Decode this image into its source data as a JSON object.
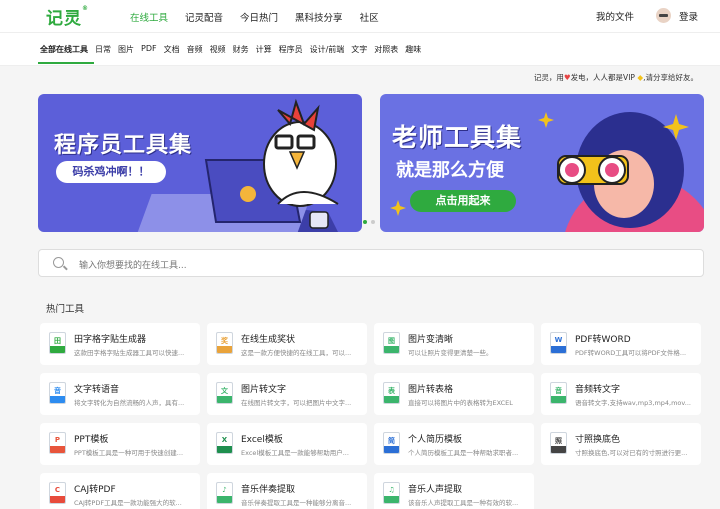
{
  "header": {
    "logo_text": "记灵",
    "logo_mark": "®",
    "nav": [
      "在线工具",
      "记灵配音",
      "今日热门",
      "黑科技分享",
      "社区"
    ],
    "my_files": "我的文件",
    "login": "登录"
  },
  "categories": [
    "全部在线工具",
    "日常",
    "图片",
    "PDF",
    "文档",
    "音频",
    "视频",
    "财务",
    "计算",
    "程序员",
    "设计/前端",
    "文字",
    "对照表",
    "趣味"
  ],
  "notice": {
    "part1": "记灵，用",
    "part2": "发电，人人都是VIP",
    "part3": ",请分享给好友。"
  },
  "banners": {
    "left": {
      "title": "程序员工具集",
      "button": "码杀鸡冲啊！！"
    },
    "right": {
      "title": "老师工具集",
      "subtitle": "就是那么方便",
      "button": "点击用起来"
    }
  },
  "search": {
    "placeholder": "输入你想要找的在线工具..."
  },
  "section_title": "热门工具",
  "tools": [
    {
      "name": "田字格字贴生成器",
      "desc": "这款田字格字贴生成器工具可以快速...",
      "icon": "tianzige-icon",
      "color": "#2faa3f",
      "glyph": "田"
    },
    {
      "name": "在线生成奖状",
      "desc": "这是一款方便快捷的在线工具，可以...",
      "icon": "certificate-icon",
      "color": "#e9a33b",
      "glyph": "奖"
    },
    {
      "name": "图片变清晰",
      "desc": "可以让照片变得更清楚一些。",
      "icon": "image-clear-icon",
      "color": "#3bb56c",
      "glyph": "图"
    },
    {
      "name": "PDF转WORD",
      "desc": "PDF转WORD工具可以将PDF文件格...",
      "icon": "pdf-word-icon",
      "color": "#2b6fd6",
      "glyph": "W"
    },
    {
      "name": "",
      "desc": "",
      "icon": "",
      "color": "",
      "glyph": ""
    },
    {
      "name": "文字转语音",
      "desc": "将文字转化为自然流畅的人声，具有...",
      "icon": "text-speech-icon",
      "color": "#2d8cf0",
      "glyph": "音"
    },
    {
      "name": "图片转文字",
      "desc": "在线图片转文字，可以把图片中文字...",
      "icon": "image-text-icon",
      "color": "#3bb56c",
      "glyph": "文"
    },
    {
      "name": "图片转表格",
      "desc": "直接可以将图片中的表格转为EXCEL",
      "icon": "image-table-icon",
      "color": "#3bb56c",
      "glyph": "表"
    },
    {
      "name": "音频转文字",
      "desc": "语音转文字,支持wav,mp3,mp4,mov...",
      "icon": "audio-text-icon",
      "color": "#3bb56c",
      "glyph": "音"
    },
    {
      "name": "",
      "desc": "",
      "icon": "",
      "color": "",
      "glyph": ""
    },
    {
      "name": "PPT模板",
      "desc": "PPT模板工具是一种可用于快速创建...",
      "icon": "ppt-icon",
      "color": "#e8553b",
      "glyph": "P"
    },
    {
      "name": "Excel模板",
      "desc": "Excel模板工具是一款能够帮助用户...",
      "icon": "excel-icon",
      "color": "#1f8f4e",
      "glyph": "X"
    },
    {
      "name": "个人简历模板",
      "desc": "个人简历模板工具是一种帮助求职者...",
      "icon": "resume-icon",
      "color": "#2b6fd6",
      "glyph": "简"
    },
    {
      "name": "寸照换底色",
      "desc": "寸照换底色,可以对已有的寸照进行更...",
      "icon": "photo-bg-icon",
      "color": "#444",
      "glyph": "照"
    },
    {
      "name": "",
      "desc": "",
      "icon": "",
      "color": "",
      "glyph": ""
    },
    {
      "name": "CAJ转PDF",
      "desc": "CAJ转PDF工具是一款功能强大的软...",
      "icon": "caj-pdf-icon",
      "color": "#e84b3b",
      "glyph": "C"
    },
    {
      "name": "音乐伴奏提取",
      "desc": "音乐伴奏提取工具是一种能够分离音...",
      "icon": "music-extract-icon",
      "color": "#3bb56c",
      "glyph": "♪"
    },
    {
      "name": "音乐人声提取",
      "desc": "该音乐人声提取工具是一种有效的软...",
      "icon": "vocal-extract-icon",
      "color": "#3bb56c",
      "glyph": "♫"
    }
  ],
  "colors": {
    "brand": "#2faa3f",
    "banner_left": "#5c5fd9",
    "banner_right": "#6a71e3"
  }
}
